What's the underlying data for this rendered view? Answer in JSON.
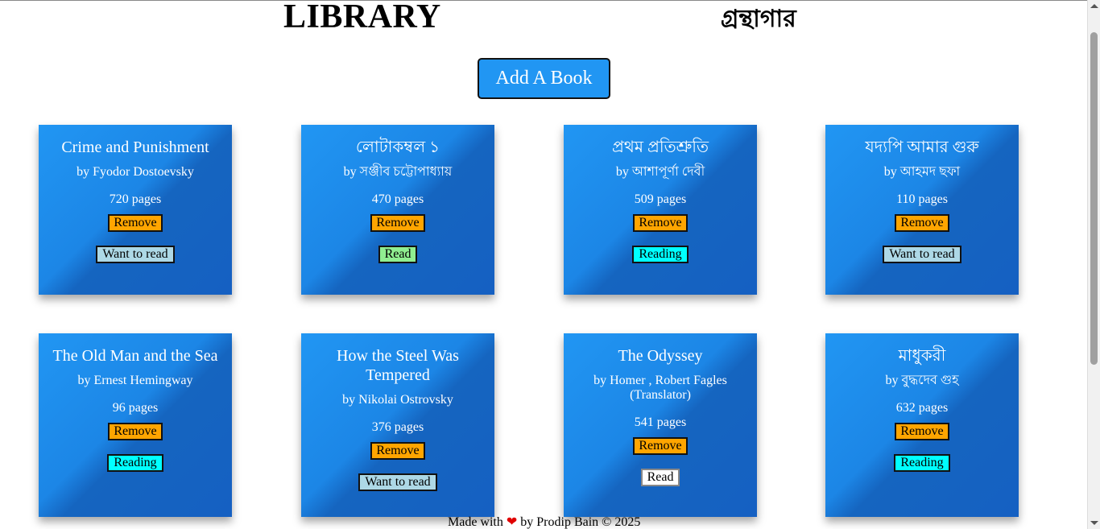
{
  "header": {
    "title_en": "LIBRARY",
    "title_bn": "গ্রন্থাগার"
  },
  "add_button": {
    "label": "Add A Book"
  },
  "books": [
    {
      "title": "Crime and Punishment",
      "author": "by Fyodor Dostoevsky",
      "pages": "720 pages",
      "remove": "Remove",
      "status": "Want to read",
      "status_class": "st-want"
    },
    {
      "title": "লোটাকম্বল ১",
      "author": "by সঞ্জীব চট্টোপাধ্যায়",
      "pages": "470 pages",
      "remove": "Remove",
      "status": "Read",
      "status_class": "st-read"
    },
    {
      "title": "প্রথম প্রতিশ্রুতি",
      "author": "by আশাপূর্ণা দেবী",
      "pages": "509 pages",
      "remove": "Remove",
      "status": "Reading",
      "status_class": "st-reading"
    },
    {
      "title": "যদ্যপি আমার গুরু",
      "author": "by আহমদ ছফা",
      "pages": "110 pages",
      "remove": "Remove",
      "status": "Want to read",
      "status_class": "st-want"
    },
    {
      "title": "The Old Man and the Sea",
      "author": "by Ernest Hemingway",
      "pages": "96 pages",
      "remove": "Remove",
      "status": "Reading",
      "status_class": "st-reading"
    },
    {
      "title": "How the Steel Was Tempered",
      "author": "by Nikolai Ostrovsky",
      "pages": "376 pages",
      "remove": "Remove",
      "status": "Want to read",
      "status_class": "st-want"
    },
    {
      "title": "The Odyssey",
      "author": "by Homer , Robert Fagles (Translator)",
      "pages": "541 pages",
      "remove": "Remove",
      "status": "Read",
      "status_class": "st-readwhite"
    },
    {
      "title": "মাধুকরী",
      "author": "by বুদ্ধদেব গুহ",
      "pages": "632 pages",
      "remove": "Remove",
      "status": "Reading",
      "status_class": "st-reading"
    }
  ],
  "footer": {
    "made_with": "Made with",
    "heart": "❤",
    "by": "by Prodip Bain © 2025"
  },
  "colors": {
    "card_gradient_start": "#2196f3",
    "card_gradient_end": "#1565c0",
    "remove_button": "#ffa500",
    "want_to_read": "#add8e6",
    "read": "#90ee90",
    "reading": "#00ffff",
    "heart": "#e00000"
  }
}
